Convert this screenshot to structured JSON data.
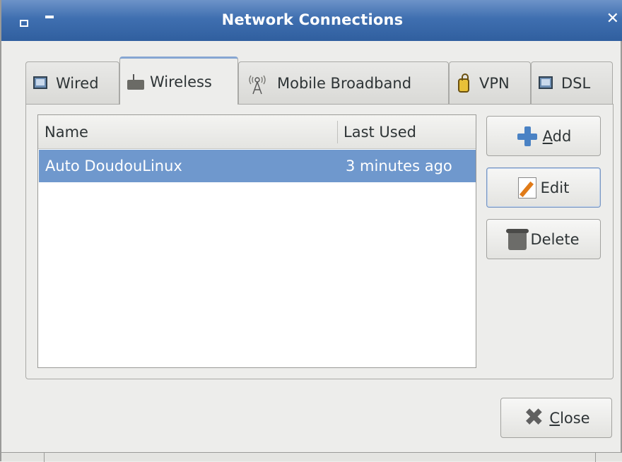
{
  "window": {
    "title": "Network Connections"
  },
  "tabs": [
    {
      "label": "Wired",
      "icon": "monitor-icon"
    },
    {
      "label": "Wireless",
      "icon": "wireless-router-icon"
    },
    {
      "label": "Mobile Broadband",
      "icon": "antenna-icon"
    },
    {
      "label": "VPN",
      "icon": "lock-icon"
    },
    {
      "label": "DSL",
      "icon": "monitor-icon"
    }
  ],
  "active_tab": "Wireless",
  "list": {
    "columns": [
      "Name",
      "Last Used"
    ],
    "rows": [
      {
        "name": "Auto DoudouLinux",
        "last_used": "3 minutes ago",
        "selected": true
      }
    ]
  },
  "buttons": {
    "add": {
      "prefix": "",
      "mnemonic": "A",
      "rest": "dd"
    },
    "edit": {
      "label": "Edit"
    },
    "delete": {
      "label": "Delete"
    },
    "close": {
      "mnemonic": "C",
      "rest": "lose"
    }
  },
  "colors": {
    "titlebar": "#3f6fb0",
    "selection": "#6f98cd"
  }
}
